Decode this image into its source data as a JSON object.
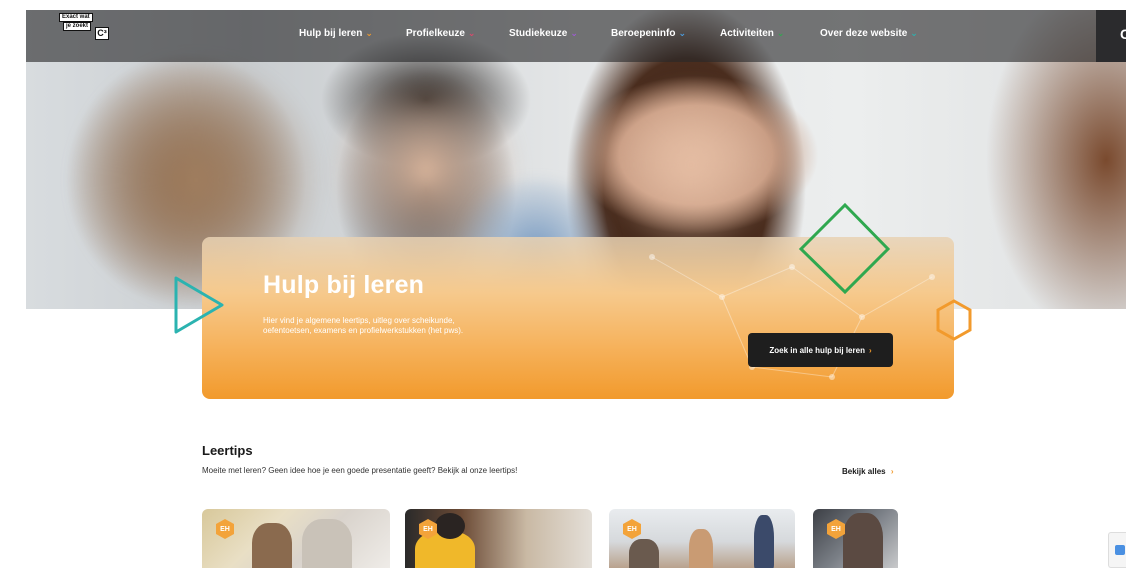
{
  "logo": {
    "line1": "Exact wat",
    "line2": "je zoekt",
    "mark": "C³"
  },
  "nav": {
    "items": [
      {
        "label": "Hulp bij leren",
        "chevron": "⌄",
        "chevron_color": "#f29a2c"
      },
      {
        "label": "Profielkeuze",
        "chevron": "⌄",
        "chevron_color": "#e0476b"
      },
      {
        "label": "Studiekeuze",
        "chevron": "⌄",
        "chevron_color": "#a05bd6"
      },
      {
        "label": "Beroepeninfo",
        "chevron": "⌄",
        "chevron_color": "#4aa0e6"
      },
      {
        "label": "Activiteiten",
        "chevron": "⌄",
        "chevron_color": "#2fa84f"
      },
      {
        "label": "Over deze website",
        "chevron": "⌄",
        "chevron_color": "#2bb3b0"
      }
    ],
    "end_label": "C"
  },
  "promo": {
    "title": "Hulp bij leren",
    "text": "Hier vind je algemene leertips, uitleg over scheikunde, oefentoetsen, examens en profielwerkstukken (het pws).",
    "button_label": "Zoek in alle hulp bij leren",
    "button_arrow": "›"
  },
  "leertips": {
    "title": "Leertips",
    "subtitle": "Moeite met leren? Geen idee hoe je een goede presentatie geeft? Bekijk al onze leertips!",
    "view_all": "Bekijk alles",
    "view_all_arrow": "›",
    "cards": [
      {
        "badge": "EH",
        "image": "classroom-lab-photo"
      },
      {
        "badge": "EH",
        "image": "student-headphones-photo"
      },
      {
        "badge": "EH",
        "image": "classroom-presentation-photo"
      },
      {
        "badge": "EH",
        "image": "student-studying-photo"
      }
    ]
  },
  "colors": {
    "accent_orange": "#f29a2c",
    "accent_green": "#2fa84f",
    "accent_teal": "#2bb3b0",
    "nav_background": "#28282a",
    "button_dark": "#1e1e1e"
  }
}
